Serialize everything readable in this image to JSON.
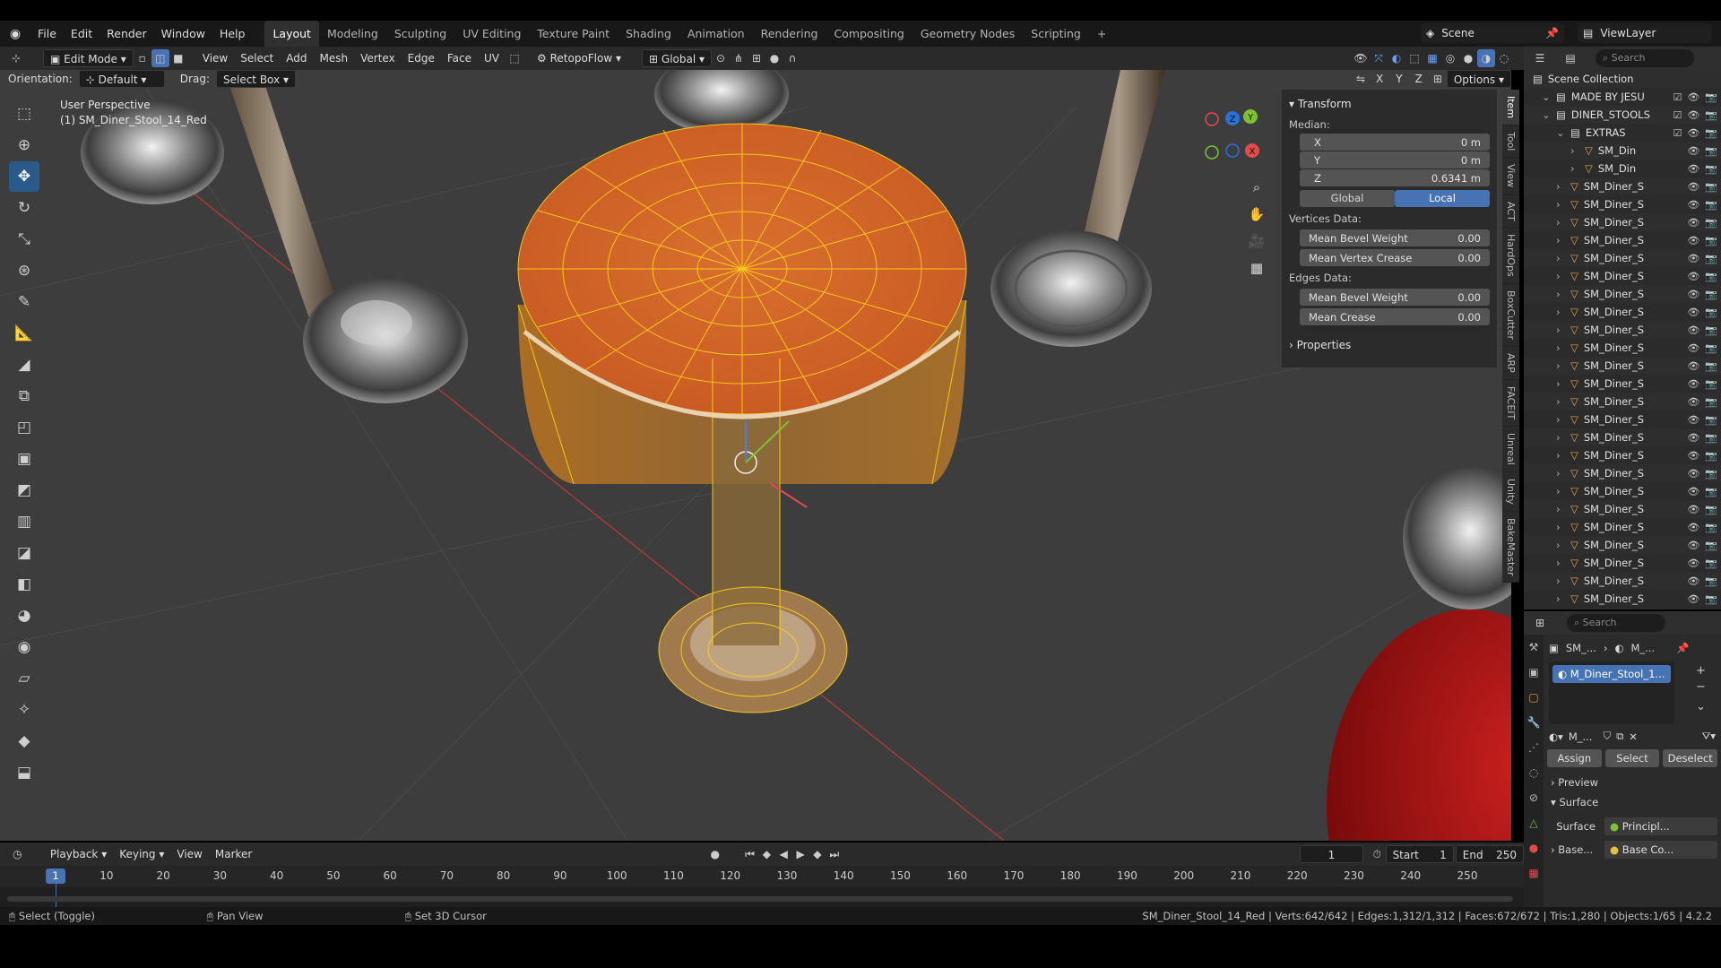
{
  "menus": [
    "File",
    "Edit",
    "Render",
    "Window",
    "Help"
  ],
  "workspaces": [
    "Layout",
    "Modeling",
    "Sculpting",
    "UV Editing",
    "Texture Paint",
    "Shading",
    "Animation",
    "Rendering",
    "Compositing",
    "Geometry Nodes",
    "Scripting"
  ],
  "scene": {
    "label": "Scene",
    "view_layer": "ViewLayer"
  },
  "header": {
    "mode": "Edit Mode",
    "menus": [
      "View",
      "Select",
      "Add",
      "Mesh",
      "Vertex",
      "Edge",
      "Face",
      "UV"
    ],
    "addon": "RetopoFlow",
    "transform_orientation": "Global"
  },
  "subheader": {
    "orientation_label": "Orientation:",
    "orientation_value": "Default",
    "drag_label": "Drag:",
    "drag_value": "Select Box",
    "axes": [
      "X",
      "Y",
      "Z"
    ],
    "options": "Options"
  },
  "viewport": {
    "perspective": "User Perspective",
    "object_name": "(1) SM_Diner_Stool_14_Red"
  },
  "npanel": {
    "transform_title": "Transform",
    "median_label": "Median:",
    "median": [
      {
        "axis": "X",
        "value": "0 m"
      },
      {
        "axis": "Y",
        "value": "0 m"
      },
      {
        "axis": "Z",
        "value": "0.6341 m"
      }
    ],
    "space": [
      "Global",
      "Local"
    ],
    "vertices_label": "Vertices Data:",
    "vertices": [
      {
        "label": "Mean Bevel Weight",
        "value": "0.00"
      },
      {
        "label": "Mean Vertex Crease",
        "value": "0.00"
      }
    ],
    "edges_label": "Edges Data:",
    "edges": [
      {
        "label": "Mean Bevel Weight",
        "value": "0.00"
      },
      {
        "label": "Mean Crease",
        "value": "0.00"
      }
    ],
    "properties": "Properties"
  },
  "vtabs": [
    "Item",
    "Tool",
    "View",
    "ACT",
    "HardOps",
    "BoxCutter",
    "ARP",
    "FACEIT",
    "Unreal",
    "Unity",
    "BakeMaster"
  ],
  "outliner": {
    "search": "Search",
    "root": "Scene Collection",
    "rows": [
      {
        "indent": 1,
        "name": "MADE BY JESU",
        "type": "col"
      },
      {
        "indent": 1,
        "name": "DINER_STOOLS",
        "type": "col"
      },
      {
        "indent": 2,
        "name": "EXTRAS",
        "type": "col"
      },
      {
        "indent": 3,
        "name": "SM_Din",
        "type": "mesh"
      },
      {
        "indent": 3,
        "name": "SM_Din",
        "type": "mesh"
      },
      {
        "indent": 2,
        "name": "SM_Diner_S",
        "type": "mesh"
      },
      {
        "indent": 2,
        "name": "SM_Diner_S",
        "type": "mesh"
      },
      {
        "indent": 2,
        "name": "SM_Diner_S",
        "type": "mesh"
      },
      {
        "indent": 2,
        "name": "SM_Diner_S",
        "type": "mesh"
      },
      {
        "indent": 2,
        "name": "SM_Diner_S",
        "type": "mesh"
      },
      {
        "indent": 2,
        "name": "SM_Diner_S",
        "type": "mesh"
      },
      {
        "indent": 2,
        "name": "SM_Diner_S",
        "type": "mesh"
      },
      {
        "indent": 2,
        "name": "SM_Diner_S",
        "type": "mesh"
      },
      {
        "indent": 2,
        "name": "SM_Diner_S",
        "type": "mesh"
      },
      {
        "indent": 2,
        "name": "SM_Diner_S",
        "type": "mesh"
      },
      {
        "indent": 2,
        "name": "SM_Diner_S",
        "type": "mesh"
      },
      {
        "indent": 2,
        "name": "SM_Diner_S",
        "type": "mesh"
      },
      {
        "indent": 2,
        "name": "SM_Diner_S",
        "type": "mesh"
      },
      {
        "indent": 2,
        "name": "SM_Diner_S",
        "type": "mesh"
      },
      {
        "indent": 2,
        "name": "SM_Diner_S",
        "type": "mesh"
      },
      {
        "indent": 2,
        "name": "SM_Diner_S",
        "type": "mesh"
      },
      {
        "indent": 2,
        "name": "SM_Diner_S",
        "type": "mesh"
      },
      {
        "indent": 2,
        "name": "SM_Diner_S",
        "type": "mesh"
      },
      {
        "indent": 2,
        "name": "SM_Diner_S",
        "type": "mesh"
      },
      {
        "indent": 2,
        "name": "SM_Diner_S",
        "type": "mesh"
      },
      {
        "indent": 2,
        "name": "SM_Diner_S",
        "type": "mesh"
      },
      {
        "indent": 2,
        "name": "SM_Diner_S",
        "type": "mesh"
      },
      {
        "indent": 2,
        "name": "SM_Diner_S",
        "type": "mesh"
      },
      {
        "indent": 2,
        "name": "SM_Diner_S",
        "type": "mesh"
      }
    ]
  },
  "props": {
    "search": "Search",
    "breadcrumb": [
      "SM_...",
      "M_..."
    ],
    "slot": "M_Diner_Stool_1...",
    "material_name": "M_...",
    "buttons": [
      "Assign",
      "Select",
      "Deselect"
    ],
    "preview": "Preview",
    "surface_panel": "Surface",
    "surface_label": "Surface",
    "surface_value": "Principl...",
    "base_label": "Base...",
    "base_value": "Base Co..."
  },
  "timeline": {
    "menus": [
      "Playback",
      "Keying",
      "View",
      "Marker"
    ],
    "current_frame": "1",
    "start_label": "Start",
    "start": "1",
    "end_label": "End",
    "end": "250",
    "ticks": [
      "10",
      "20",
      "30",
      "40",
      "50",
      "60",
      "70",
      "80",
      "90",
      "100",
      "110",
      "120",
      "130",
      "140",
      "150",
      "160",
      "170",
      "180",
      "190",
      "200",
      "210",
      "220",
      "230",
      "240",
      "250"
    ],
    "frame_badge": "1"
  },
  "status": {
    "left": [
      {
        "key": "Select (Toggle)"
      },
      {
        "key": "Pan View"
      },
      {
        "key": "Set 3D Cursor"
      }
    ],
    "right": "SM_Diner_Stool_14_Red | Verts:642/642 | Edges:1,312/1,312 | Faces:672/672 | Tris:1,280 | Objects:1/65 | 4.2.2"
  },
  "colors": {
    "accent": "#4772b3",
    "selection": "#ffb000",
    "seat": "#d8682c",
    "x_axis": "#e34a4a",
    "y_axis": "#7ec233",
    "z_axis": "#4a7de3"
  }
}
